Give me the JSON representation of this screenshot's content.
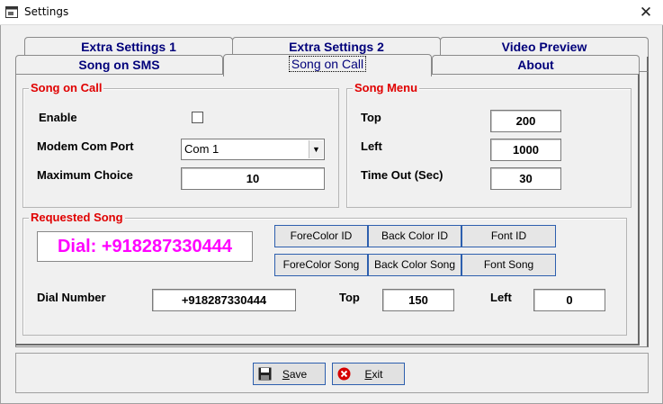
{
  "window": {
    "title": "Settings"
  },
  "tabs": {
    "row_back": [
      "Extra Settings 1",
      "Extra Settings 2",
      "Video Preview"
    ],
    "row_front": [
      "Song on SMS",
      "Song on Call",
      "About"
    ]
  },
  "song_on_call": {
    "title": "Song on Call",
    "enable_label": "Enable",
    "enable_checked": false,
    "modem_label": "Modem Com Port",
    "modem_value": "Com 1",
    "max_choice_label": "Maximum Choice",
    "max_choice_value": "10"
  },
  "song_menu": {
    "title": "Song Menu",
    "top_label": "Top",
    "top_value": "200",
    "left_label": "Left",
    "left_value": "1000",
    "timeout_label": "Time Out (Sec)",
    "timeout_value": "30"
  },
  "requested_song": {
    "title": "Requested Song",
    "preview_text": "Dial: +918287330444",
    "preview_color": "#ff00ff",
    "buttons": [
      "ForeColor ID",
      "Back Color ID",
      "Font ID",
      "ForeColor Song",
      "Back Color Song",
      "Font Song"
    ],
    "dial_label": "Dial Number",
    "dial_value": "+918287330444",
    "top_label": "Top",
    "top_value": "150",
    "left_label": "Left",
    "left_value": "0"
  },
  "actions": {
    "save_prefix": "S",
    "save_rest": "ave",
    "exit_prefix": "E",
    "exit_rest": "xit"
  },
  "colors": {
    "group_title": "#e00000",
    "tab_text": "#00007a",
    "button_border": "#2d5fae"
  }
}
